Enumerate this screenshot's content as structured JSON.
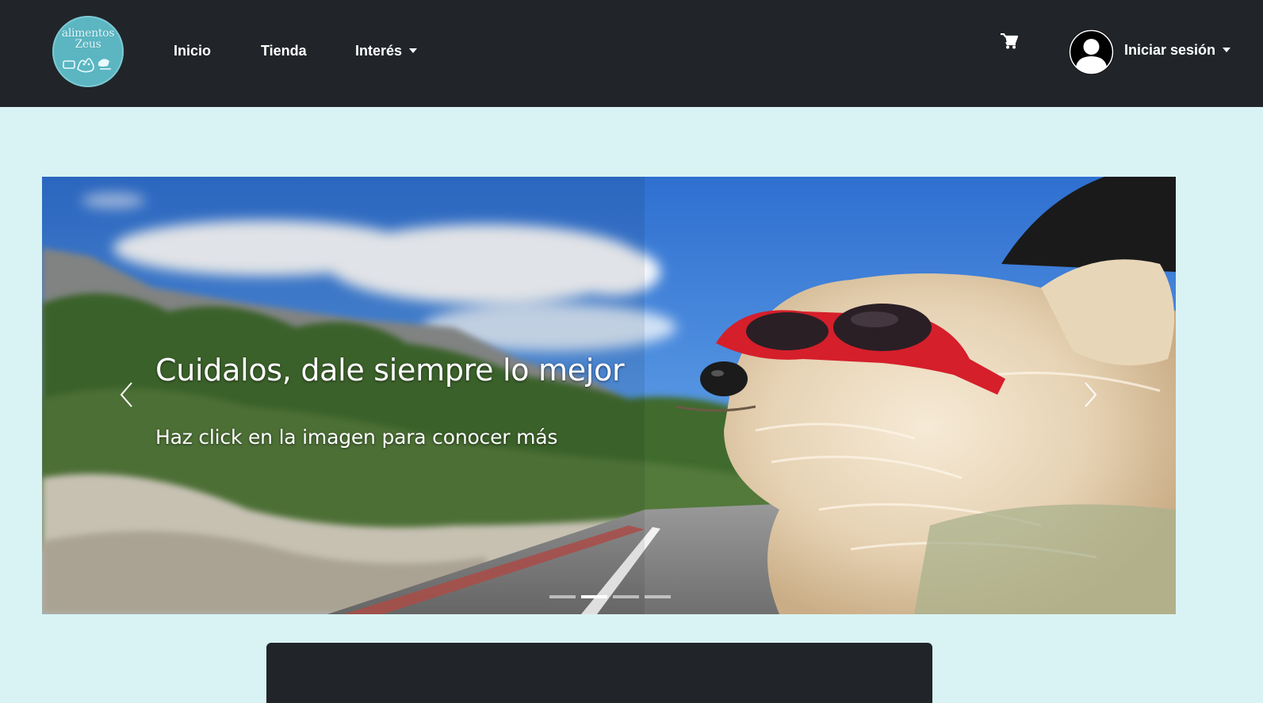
{
  "brand": {
    "logo_text_line1": "alimentos",
    "logo_text_line2": "Zeus",
    "logo_bg": "#5bb6c2"
  },
  "nav": {
    "items": [
      {
        "label": "Inicio"
      },
      {
        "label": "Tienda"
      },
      {
        "label": "Interés",
        "dropdown": true
      }
    ],
    "cart_icon": "shopping-cart-icon",
    "account": {
      "label": "Iniciar sesión",
      "icon": "user-avatar-icon",
      "dropdown": true
    }
  },
  "carousel": {
    "caption_title": "Cuidalos, dale siempre lo mejor",
    "caption_text": "Haz click en la imagen para conocer más",
    "slide_count": 4,
    "active_index": 1,
    "prev_icon": "chevron-left-icon",
    "next_icon": "chevron-right-icon"
  },
  "colors": {
    "navbar": "#212529",
    "page_bg": "#d9f3f4",
    "text_light": "#ffffff"
  }
}
